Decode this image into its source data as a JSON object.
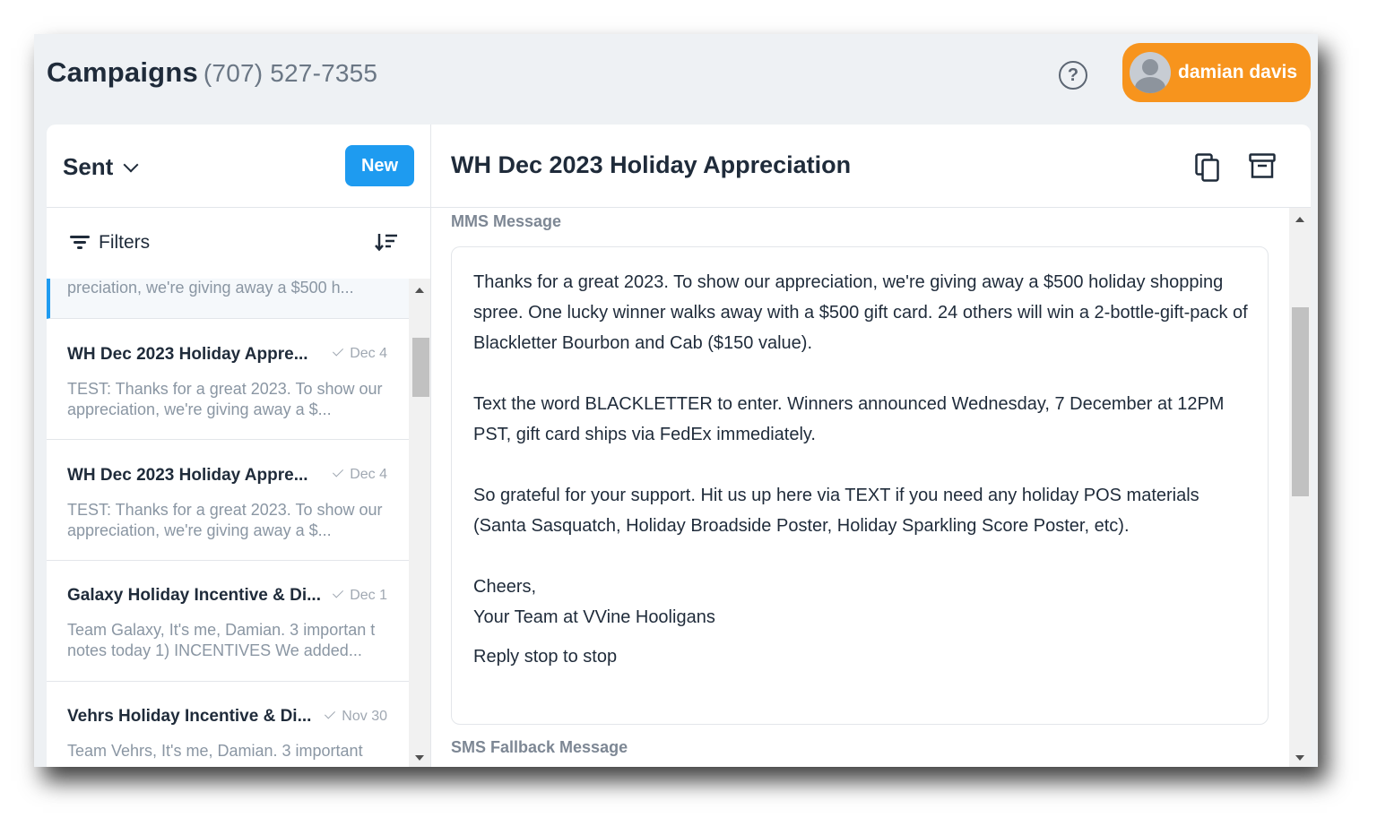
{
  "header": {
    "title": "Campaigns",
    "phone": "(707) 527-7355",
    "help_icon": "help-circle-icon",
    "user": {
      "name": "damian davis",
      "avatar_icon": "avatar-icon",
      "color": "#f7941d"
    }
  },
  "sidebar": {
    "folder": "Sent",
    "new_label": "New",
    "filters_label": "Filters",
    "accent_color": "#1e9bf0",
    "active_partial_preview": "preciation, we're giving away a $500 h...",
    "items": [
      {
        "title": "WH Dec 2023 Holiday Appre...",
        "date": "Dec 4",
        "preview": "TEST: Thanks for a great 2023. To show our appreciation, we're giving away a $..."
      },
      {
        "title": "WH Dec 2023 Holiday Appre...",
        "date": "Dec 4",
        "preview": "TEST: Thanks for a great 2023. To show our appreciation, we're giving away a $..."
      },
      {
        "title": "Galaxy Holiday Incentive & Di...",
        "date": "Dec 1",
        "preview": "Team Galaxy, It's me, Damian. 3 importan t notes today 1) INCENTIVES We added..."
      },
      {
        "title": "Vehrs Holiday Incentive & Di...",
        "date": "Nov 30",
        "preview": "Team Vehrs, It's me, Damian. 3 important"
      }
    ]
  },
  "detail": {
    "title": "WH Dec 2023 Holiday Appreciation",
    "mms_label": "MMS Message",
    "message": {
      "p1": "Thanks for a great 2023. To show our appreciation, we're giving away a $500 holiday shopping spree. One lucky winner walks away with a $500 gift card. 24 others will win a 2-bottle-gift-pack of Blackletter Bourbon and Cab ($150 value).",
      "p2": "Text the word BLACKLETTER to enter. Winners announced Wednesday, 7 December at 12PM PST, gift card ships via FedEx immediately.",
      "p3": "So grateful for your support. Hit us up here via TEXT if you need any holiday POS materials (Santa Sasquatch, Holiday Broadside Poster, Holiday Sparkling Score Poster, etc).",
      "closing": "Cheers,",
      "signature": "Your Team at VVine Hooligans",
      "reply": "Reply stop to stop"
    },
    "sms_label": "SMS Fallback Message"
  }
}
